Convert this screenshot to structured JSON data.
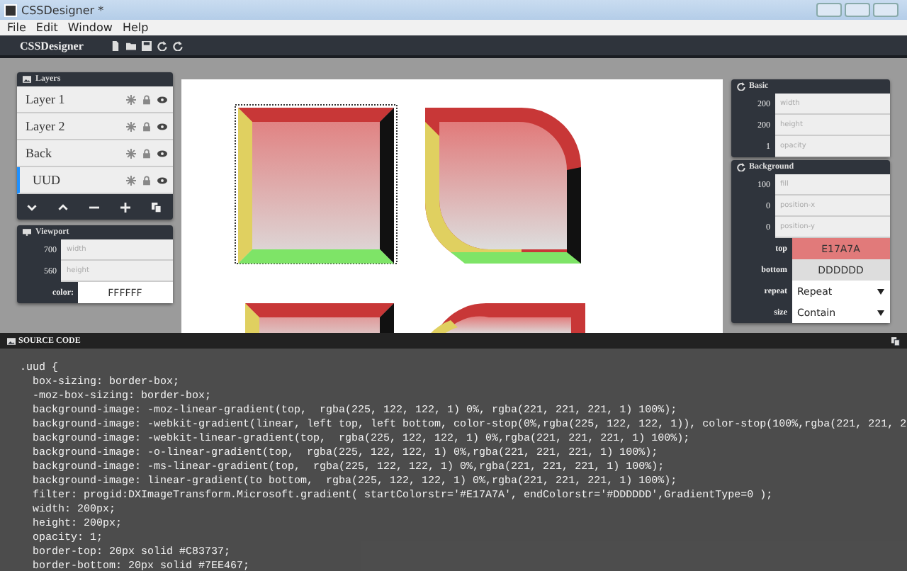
{
  "window": {
    "title": "CSSDesigner *"
  },
  "menu": [
    "File",
    "Edit",
    "Window",
    "Help"
  ],
  "toolbar": {
    "title": "CSSDesigner"
  },
  "layers": {
    "title": "Layers",
    "items": [
      {
        "name": "Layer 1",
        "selected": false
      },
      {
        "name": "Layer 2",
        "selected": false
      },
      {
        "name": "Back",
        "selected": false
      },
      {
        "name": "UUD",
        "selected": true
      }
    ]
  },
  "viewport": {
    "title": "Viewport",
    "rows": [
      {
        "kind": "slider",
        "value": "700",
        "label": "width"
      },
      {
        "kind": "slider",
        "value": "560",
        "label": "height"
      },
      {
        "kind": "color",
        "label": "color:",
        "value": "FFFFFF",
        "color": "#ffffff"
      }
    ]
  },
  "basic": {
    "title": "Basic",
    "rows": [
      {
        "kind": "slider",
        "value": "200",
        "label": "width"
      },
      {
        "kind": "slider",
        "value": "200",
        "label": "height"
      },
      {
        "kind": "slider",
        "value": "1",
        "label": "opacity"
      }
    ]
  },
  "background": {
    "title": "Background",
    "rows": [
      {
        "kind": "slider",
        "value": "100",
        "label": "fill"
      },
      {
        "kind": "slider",
        "value": "0",
        "label": "position-x"
      },
      {
        "kind": "slider",
        "value": "0",
        "label": "position-y"
      },
      {
        "kind": "color",
        "label": "top",
        "value": "E17A7A",
        "color": "#e17a7a"
      },
      {
        "kind": "color",
        "label": "bottom",
        "value": "DDDDDD",
        "color": "#dddddd"
      },
      {
        "kind": "select",
        "label": "repeat",
        "value": "Repeat"
      },
      {
        "kind": "select",
        "label": "size",
        "value": "Contain"
      }
    ]
  },
  "source_code": {
    "title": "SOURCE CODE",
    "lines": [
      ".uud {",
      "  box-sizing: border-box;",
      "  -moz-box-sizing: border-box;",
      "  background-image: -moz-linear-gradient(top,  rgba(225, 122, 122, 1) 0%, rgba(221, 221, 221, 1) 100%);",
      "  background-image: -webkit-gradient(linear, left top, left bottom, color-stop(0%,rgba(225, 122, 122, 1)), color-stop(100%,rgba(221, 221, 2",
      "  background-image: -webkit-linear-gradient(top,  rgba(225, 122, 122, 1) 0%,rgba(221, 221, 221, 1) 100%);",
      "  background-image: -o-linear-gradient(top,  rgba(225, 122, 122, 1) 0%,rgba(221, 221, 221, 1) 100%);",
      "  background-image: -ms-linear-gradient(top,  rgba(225, 122, 122, 1) 0%,rgba(221, 221, 221, 1) 100%);",
      "  background-image: linear-gradient(to bottom,  rgba(225, 122, 122, 1) 0%,rgba(221, 221, 221, 1) 100%);",
      "  filter: progid:DXImageTransform.Microsoft.gradient( startColorstr='#E17A7A', endColorstr='#DDDDDD',GradientType=0 );",
      "  width: 200px;",
      "  height: 200px;",
      "  opacity: 1;",
      "  border-top: 20px solid #C83737;",
      "  border-bottom: 20px solid #7EE467;"
    ]
  }
}
